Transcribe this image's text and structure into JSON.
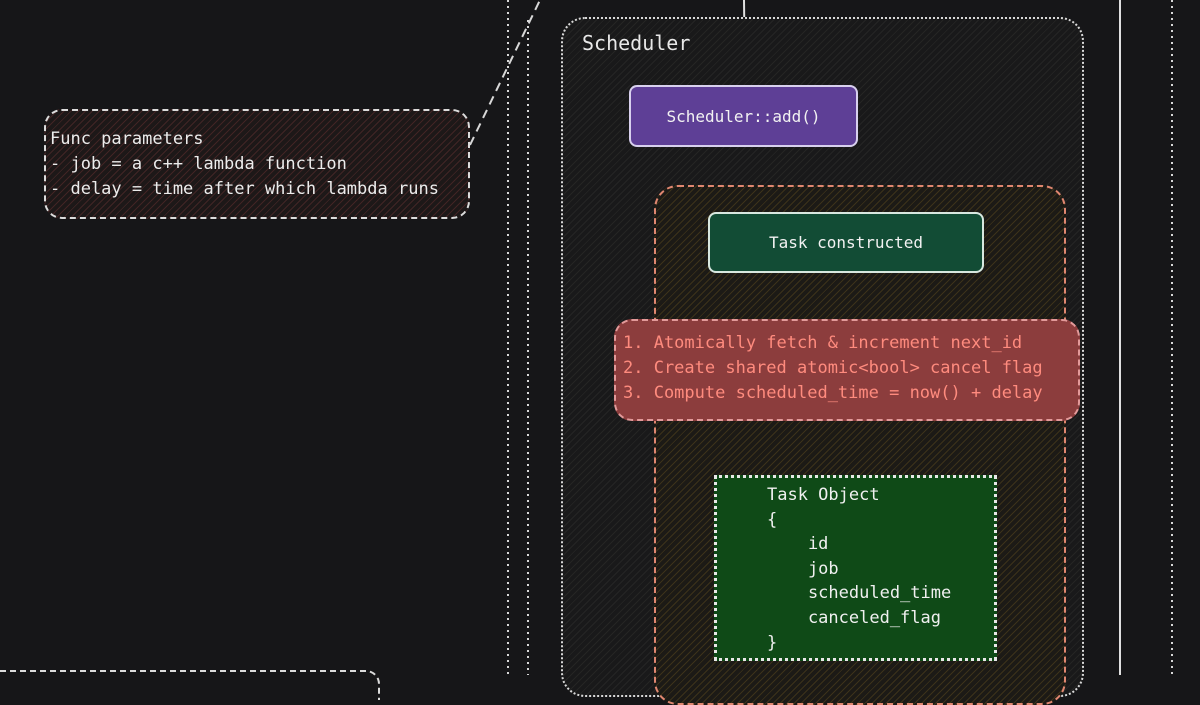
{
  "scheduler": {
    "title": "Scheduler",
    "add_node": "Scheduler::add()",
    "task_constructed": "Task constructed",
    "steps": [
      "1. Atomically fetch & increment next_id",
      "2. Create shared atomic<bool> cancel flag",
      "3. Compute scheduled_time = now() + delay"
    ],
    "task_object": {
      "lines": [
        "Task Object",
        "{",
        "    id",
        "    job",
        "    scheduled_time",
        "    canceled_flag",
        "}"
      ]
    }
  },
  "func_params": {
    "lines": [
      "Func parameters",
      "- job = a c++ lambda function",
      "- delay = time after which lambda runs"
    ]
  },
  "colors": {
    "background": "#161618",
    "add_node_fill": "#5e3f96",
    "task_constructed_fill": "#124c35",
    "steps_fill": "#8c3d3d",
    "steps_text": "#ff8b7e",
    "task_object_fill": "#0f4a17",
    "task_container_border": "#e08770"
  }
}
